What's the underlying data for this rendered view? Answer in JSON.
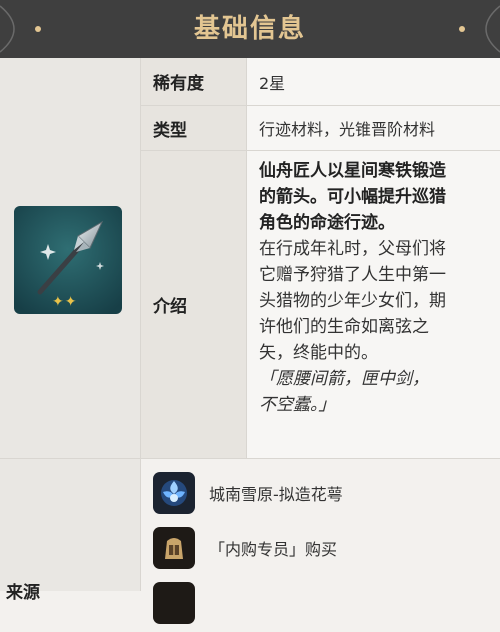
{
  "header": {
    "title": "基础信息"
  },
  "rows": {
    "rarity": {
      "label": "稀有度",
      "value": "2星"
    },
    "type": {
      "label": "类型",
      "value": "行迹材料，光锥晋阶材料"
    },
    "intro": {
      "label": "介绍",
      "bold_lines": [
        "仙舟匠人以星间寒铁锻造",
        "的箭头。可小幅提升巡猎",
        "角色的命途行迹。"
      ],
      "plain_lines": [
        "在行成年礼时，父母们将",
        "它赠予狩猎了人生中第一",
        "头猎物的少年少女们，期",
        "许他们的生命如离弦之",
        "矢，终能中的。"
      ],
      "quote_lines": [
        "「愿腰间箭，匣中剑，",
        "不空蠹。」"
      ]
    },
    "source": {
      "label": "来源",
      "items": [
        {
          "icon": "blue-flower-icon",
          "text": "城南雪原-拟造花萼"
        },
        {
          "icon": "merchant-icon",
          "text": "「内购专员」购买"
        }
      ]
    }
  },
  "item": {
    "icon": "arrowhead-icon",
    "rarity_stars": 2
  },
  "colors": {
    "header_bg": "#3f3f3f",
    "header_text": "#e3c692",
    "thumb_bg": "#1f4f57",
    "star": "#e8c24a"
  }
}
